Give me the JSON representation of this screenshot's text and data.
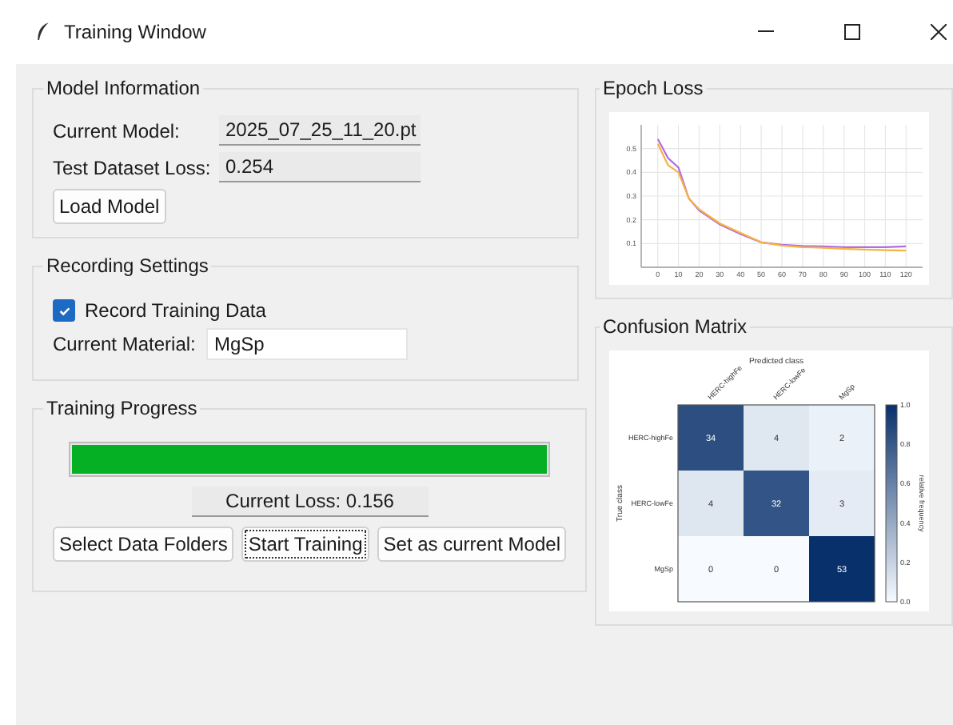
{
  "window": {
    "title": "Training Window"
  },
  "model_information": {
    "title": "Model Information",
    "fields": [
      {
        "label": "Current Model:",
        "value": "2025_07_25_11_20.pt"
      },
      {
        "label": "Test Dataset Loss:",
        "value": "0.254"
      }
    ],
    "button": "Load Model"
  },
  "recording_settings": {
    "title": "Recording Settings",
    "checkbox": {
      "label": "Record Training Data",
      "checked": true
    },
    "field": {
      "label": "Current Material:",
      "value": "MgSp"
    }
  },
  "training_progress": {
    "title": "Training Progress",
    "level": 1,
    "current_loss": "Current Loss: 0.156",
    "buttons": [
      {
        "label": "Select Data Folders",
        "focused": false
      },
      {
        "label": "Start Training",
        "focused": true
      },
      {
        "label": "Set as current Model",
        "focused": false
      }
    ]
  },
  "epoch_loss": {
    "title": "Epoch Loss",
    "chart_data": {
      "type": "line",
      "grid": true,
      "x": [
        0,
        5,
        10,
        15,
        20,
        30,
        40,
        50,
        60,
        70,
        80,
        90,
        100,
        110,
        120
      ],
      "xlim": [
        -8,
        128
      ],
      "ylim": [
        0,
        0.6
      ],
      "xticks": [
        0,
        10,
        20,
        30,
        40,
        50,
        60,
        70,
        80,
        90,
        100,
        110,
        120
      ],
      "yticks": [
        0.1,
        0.2,
        0.3,
        0.4,
        0.5
      ],
      "series": [
        {
          "color": "#b36ae2",
          "values": [
            0.54,
            0.46,
            0.42,
            0.29,
            0.24,
            0.18,
            0.14,
            0.105,
            0.095,
            0.09,
            0.088,
            0.085,
            0.085,
            0.085,
            0.088
          ]
        },
        {
          "color": "#f5b342",
          "values": [
            0.52,
            0.43,
            0.4,
            0.29,
            0.245,
            0.185,
            0.145,
            0.105,
            0.092,
            0.085,
            0.082,
            0.078,
            0.075,
            0.072,
            0.07
          ]
        }
      ]
    }
  },
  "confusion_matrix": {
    "title": "Confusion Matrix",
    "xlabel": "Predicted class",
    "ylabel": "True class",
    "column_classes": [
      "HERC-highFe",
      "HERC-lowFe",
      "MgSp"
    ],
    "row_classes": [
      "HERC-highFe",
      "HERC-lowFe",
      "MgSp"
    ],
    "rows": [
      [
        "34",
        "4",
        "2"
      ],
      [
        "4",
        "32",
        "3"
      ],
      [
        "0",
        "0",
        "53"
      ]
    ],
    "colorbar": {
      "label": "relative frequency",
      "ticks": [
        "1.0",
        "0.8",
        "0.6",
        "0.4",
        "0.2",
        "0.0"
      ]
    }
  }
}
